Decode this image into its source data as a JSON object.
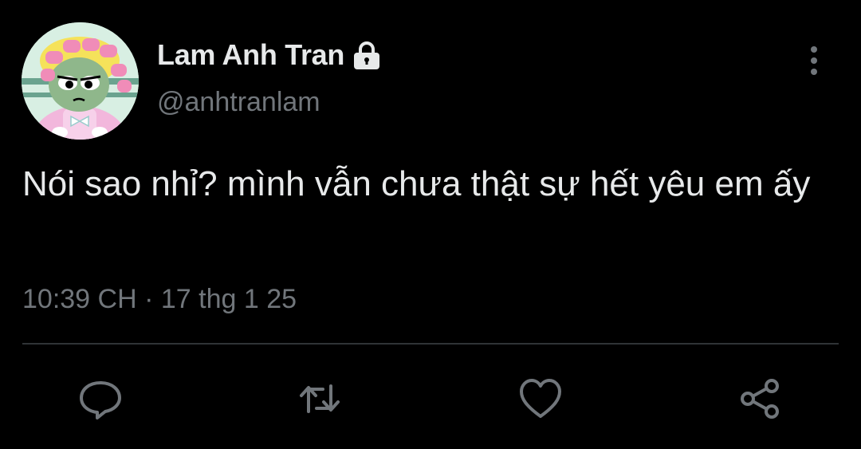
{
  "tweet": {
    "author": {
      "display_name": "Lam Anh Tran",
      "handle": "@anhtranlam",
      "protected_icon": "lock-icon",
      "avatar_icon": "cartoon-avatar"
    },
    "text": "Nói sao nhỉ? mình vẫn chưa thật sự hết yêu em ấy",
    "time": "10:39 CH",
    "separator": " · ",
    "date": "17 thg 1 25",
    "more_icon": "more-vertical-icon",
    "actions": [
      {
        "icon": "reply-icon"
      },
      {
        "icon": "retweet-icon"
      },
      {
        "icon": "like-icon"
      },
      {
        "icon": "share-icon"
      }
    ]
  },
  "colors": {
    "background": "#000000",
    "primary_text": "#e7e9ea",
    "secondary_text": "#71767b",
    "divider": "#2f3336"
  }
}
